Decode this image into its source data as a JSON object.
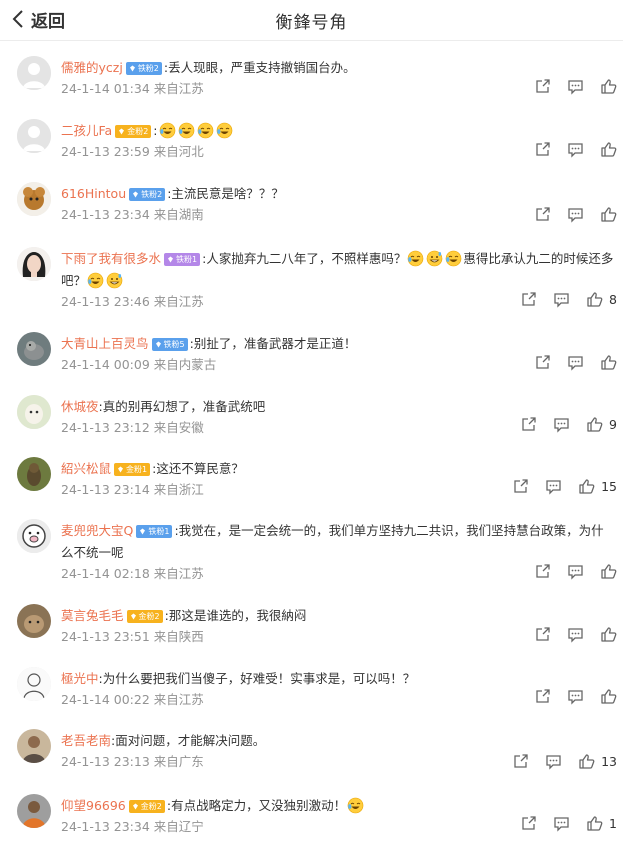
{
  "header": {
    "back_label": "返回",
    "title": "衡鋒号角"
  },
  "colors": {
    "username": "#eb7350",
    "meta": "#939393",
    "badge_blue": "#5aa0ec",
    "badge_gold": "#f7b21e",
    "badge_purple": "#b487e8"
  },
  "comments": [
    {
      "user": "儒雅的yczj",
      "badge": "铁粉2",
      "badge_color": "blue",
      "text": ":丢人现眼，严重支持撤销国台办。",
      "emojis": [],
      "emojis_after": [],
      "time": "24-1-14 01:34",
      "location": "来自江苏",
      "likes": "",
      "avatar": "default-avatar"
    },
    {
      "user": "二孩儿Fa",
      "badge": "金粉2",
      "badge_color": "gold",
      "text": ":",
      "emojis": [
        "laughing-tears-emoji",
        "laughing-tears-emoji",
        "laughing-tears-emoji",
        "laughing-tears-emoji"
      ],
      "emojis_after": [],
      "time": "24-1-13 23:59",
      "location": "来自河北",
      "likes": "",
      "avatar": "default-avatar"
    },
    {
      "user": "616Hintou",
      "badge": "铁粉2",
      "badge_color": "blue",
      "text": ":主流民意是啥？？？",
      "emojis": [],
      "emojis_after": [],
      "time": "24-1-13 23:34",
      "location": "来自湖南",
      "likes": "",
      "avatar": "cartoon-avatar"
    },
    {
      "user": "下雨了我有很多水",
      "badge": "铁粉1",
      "badge_color": "purple",
      "text": ":人家抛弃九二八年了，不照样惠吗？",
      "text_tail": "惠得比承认九二的时候还多吧？",
      "emojis": [
        "laughing-tears-emoji",
        "grin-sweat-emoji",
        "laughing-tears-emoji"
      ],
      "emojis_after": [
        "laughing-tears-emoji",
        "grin-sweat-emoji"
      ],
      "time": "24-1-13 23:46",
      "location": "来自江苏",
      "likes": "8",
      "avatar": "girl-avatar"
    },
    {
      "user": "大青山上百灵鸟",
      "badge": "铁粉5",
      "badge_color": "blue",
      "text": ":别扯了，准备武器才是正道！",
      "emojis": [],
      "emojis_after": [],
      "time": "24-1-14 00:09",
      "location": "来自内蒙古",
      "likes": "",
      "avatar": "bird-avatar"
    },
    {
      "user": "休城夜",
      "badge": "",
      "badge_color": "",
      "text": ":真的别再幻想了，准备武统吧",
      "emojis": [],
      "emojis_after": [],
      "time": "24-1-13 23:12",
      "location": "来自安徽",
      "likes": "9",
      "avatar": "alpaca-avatar"
    },
    {
      "user": "紹兴松鼠",
      "badge": "金粉1",
      "badge_color": "gold",
      "text": ":这还不算民意？",
      "emojis": [],
      "emojis_after": [],
      "time": "24-1-13 23:14",
      "location": "来自浙江",
      "likes": "15",
      "avatar": "squirrel-avatar"
    },
    {
      "user": "麦兜兜大宝Q",
      "badge": "铁粉1",
      "badge_color": "blue",
      "text": ":我觉在，是一定会统一的，我们单方坚持九二共识，我们坚持慧台政策，为什么不统一呢",
      "emojis": [],
      "emojis_after": [],
      "time": "24-1-14 02:18",
      "location": "来自江苏",
      "likes": "",
      "avatar": "pig-avatar"
    },
    {
      "user": "莫言兔毛毛",
      "badge": "金粉2",
      "badge_color": "gold",
      "text": ":那这是谁选的，我很納闷",
      "emojis": [],
      "emojis_after": [],
      "time": "24-1-13 23:51",
      "location": "来自陕西",
      "likes": "",
      "avatar": "rabbit-avatar"
    },
    {
      "user": "極光中",
      "badge": "",
      "badge_color": "",
      "text": ":为什么要把我们当傻子，好难受！实事求是，可以吗！？",
      "emojis": [],
      "emojis_after": [],
      "time": "24-1-14 00:22",
      "location": "来自江苏",
      "likes": "",
      "avatar": "sketch-avatar"
    },
    {
      "user": "老吾老南",
      "badge": "",
      "badge_color": "",
      "text": ":面对问题，才能解决问题。",
      "emojis": [],
      "emojis_after": [],
      "time": "24-1-13 23:13",
      "location": "来自广东",
      "likes": "13",
      "avatar": "man-avatar"
    },
    {
      "user": "仰望96696",
      "badge": "金粉2",
      "badge_color": "gold",
      "text": ":有点战略定力，又没独别激动！",
      "emojis": [],
      "emojis_after": [
        "laughing-tears-emoji"
      ],
      "time": "24-1-13 23:34",
      "location": "来自辽宁",
      "likes": "1",
      "avatar": "orange-avatar"
    }
  ]
}
